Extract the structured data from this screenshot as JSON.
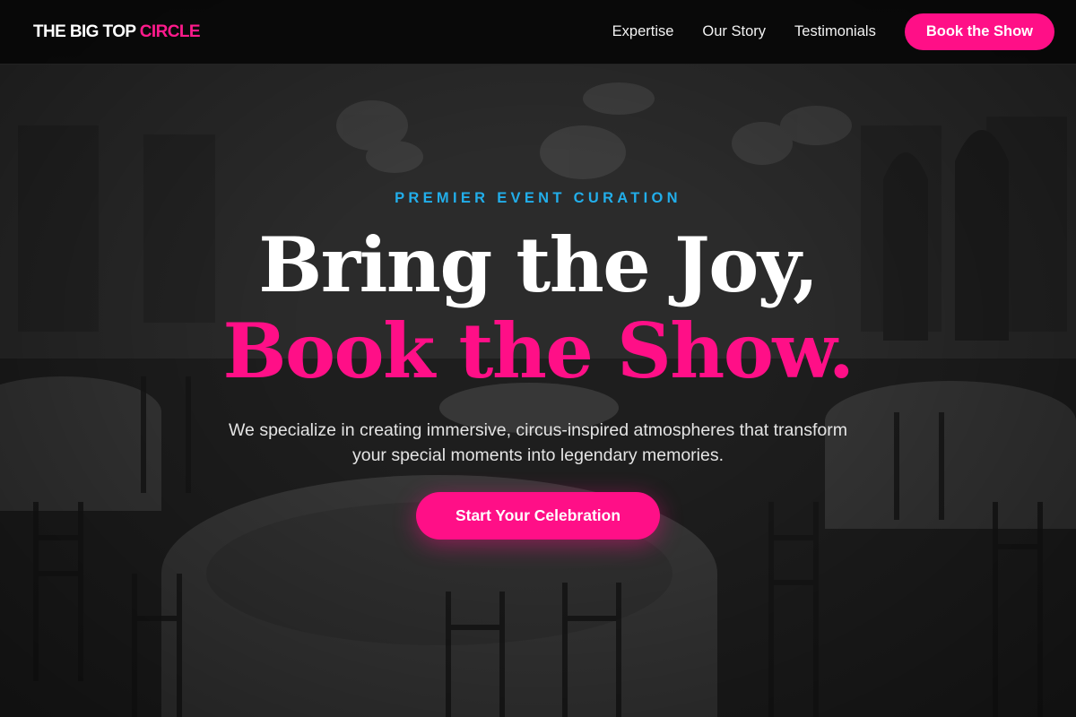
{
  "brand": {
    "main": "THE BIG TOP ",
    "accent": "CIRCLE"
  },
  "nav": {
    "links": [
      "Expertise",
      "Our Story",
      "Testimonials"
    ],
    "cta": "Book the Show"
  },
  "hero": {
    "eyebrow": "PREMIER EVENT CURATION",
    "headline_line1": "Bring the Joy,",
    "headline_line2": "Book the Show.",
    "subtitle": "We specialize in creating immersive, circus-inspired atmospheres that transform your special moments into legendary memories.",
    "cta": "Start Your Celebration"
  },
  "colors": {
    "accent_pink": "#ff0f87",
    "eyebrow_blue": "#22aeea",
    "nav_background": "#080808"
  }
}
